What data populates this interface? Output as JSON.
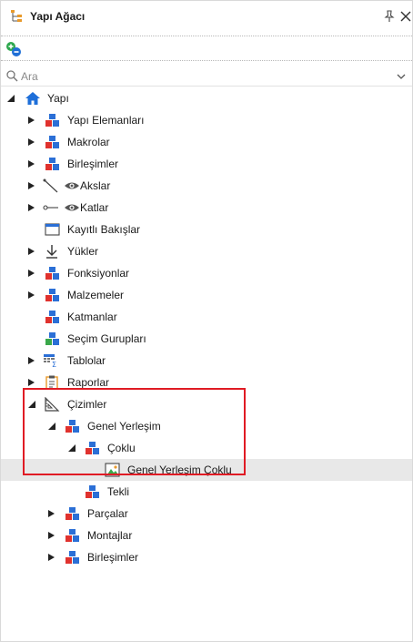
{
  "panel": {
    "title": "Yapı Ağacı"
  },
  "search": {
    "placeholder": "Ara"
  },
  "tree": {
    "root": "Yapı",
    "items": {
      "yapi_elemanlari": "Yapı Elemanları",
      "makrolar": "Makrolar",
      "birlesimler": "Birleşimler",
      "akslar": "Akslar",
      "katlar": "Katlar",
      "kayitli_bakislar": "Kayıtlı Bakışlar",
      "yukler": "Yükler",
      "fonksiyonlar": "Fonksiyonlar",
      "malzemeler": "Malzemeler",
      "katmanlar": "Katmanlar",
      "secim_guruplari": "Seçim Gurupları",
      "tablolar": "Tablolar",
      "raporlar": "Raporlar",
      "cizimler": "Çizimler",
      "genel_yerlesim": "Genel Yerleşim",
      "coklu": "Çoklu",
      "genel_yerlesim_coklu": "Genel Yerleşim Çoklu",
      "tekli": "Tekli",
      "parcalar": "Parçalar",
      "montajlar": "Montajlar",
      "birlesimler_2": "Birleşimler"
    }
  },
  "colors": {
    "highlight": "#e01b24",
    "selected_row": "#e8e8e8",
    "home_blue": "#1e6fd9",
    "block_red": "#e0322e",
    "block_blue": "#2b6fd6",
    "block_green": "#3aa84a"
  }
}
